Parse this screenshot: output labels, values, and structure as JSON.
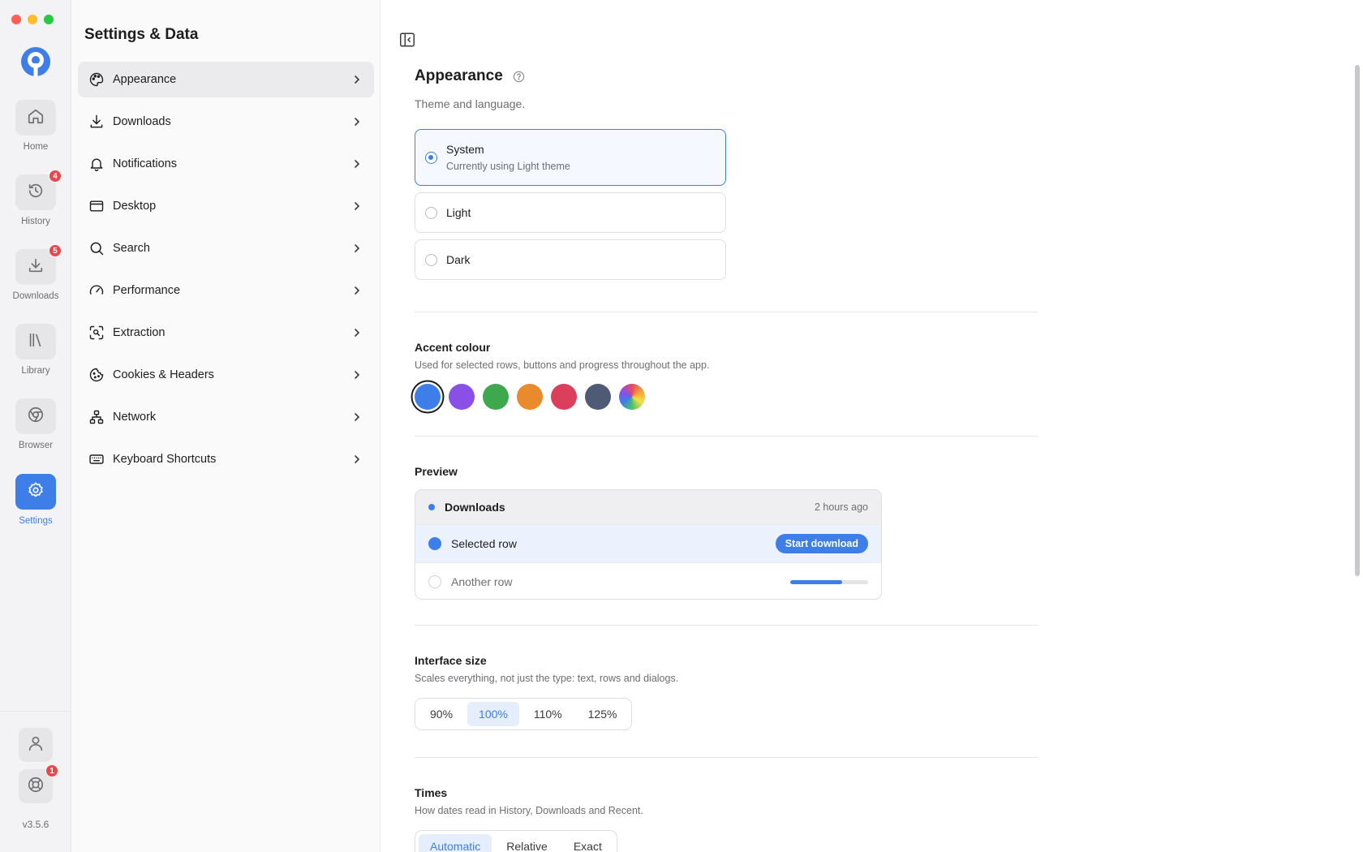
{
  "rail": {
    "items": [
      {
        "label": "Home",
        "icon": "home-icon"
      },
      {
        "label": "History",
        "icon": "history-icon",
        "badge": "4"
      },
      {
        "label": "Downloads",
        "icon": "download-icon",
        "badge": "5"
      },
      {
        "label": "Library",
        "icon": "library-icon"
      },
      {
        "label": "Browser",
        "icon": "browser-icon"
      },
      {
        "label": "Settings",
        "icon": "gear-icon",
        "active": true
      }
    ],
    "support_badge": "1",
    "version": "v3.5.6"
  },
  "nav": {
    "title": "Settings & Data",
    "items": [
      {
        "label": "Appearance",
        "icon": "palette-icon"
      },
      {
        "label": "Downloads",
        "icon": "download-icon"
      },
      {
        "label": "Notifications",
        "icon": "bell-icon"
      },
      {
        "label": "Desktop",
        "icon": "window-icon"
      },
      {
        "label": "Search",
        "icon": "search-icon"
      },
      {
        "label": "Performance",
        "icon": "gauge-icon"
      },
      {
        "label": "Extraction",
        "icon": "scan-icon"
      },
      {
        "label": "Cookies & Headers",
        "icon": "cookie-icon"
      },
      {
        "label": "Network",
        "icon": "network-icon"
      },
      {
        "label": "Keyboard Shortcuts",
        "icon": "keyboard-icon"
      }
    ]
  },
  "appearance": {
    "title": "Appearance",
    "subtitle": "Theme and language.",
    "theme_options": [
      {
        "label": "System",
        "sub": "Currently using Light theme",
        "selected": true
      },
      {
        "label": "Light"
      },
      {
        "label": "Dark"
      }
    ]
  },
  "accent": {
    "title": "Accent colour",
    "subtitle": "Used for selected rows, buttons and progress throughout the app.",
    "colors": [
      "#3d7ee8",
      "#8a4fe6",
      "#3ea84e",
      "#e98a2c",
      "#dc3f5c",
      "#4f5b75",
      "multicolor"
    ],
    "selected_index": 0
  },
  "preview": {
    "title": "Preview",
    "header_label": "Downloads",
    "header_time": "2 hours ago",
    "selected_row": "Selected row",
    "button_label": "Start download",
    "other_row": "Another row",
    "progress": 0.67
  },
  "interface_size": {
    "title": "Interface size",
    "subtitle": "Scales everything, not just the type: text, rows and dialogs.",
    "options": [
      "90%",
      "100%",
      "110%",
      "125%"
    ],
    "selected_index": 1
  },
  "times": {
    "title": "Times",
    "subtitle": "How dates read in History, Downloads and Recent.",
    "options": [
      "Automatic",
      "Relative",
      "Exact"
    ],
    "selected_index": 0
  },
  "colors": {
    "accent": "#3d7ee8",
    "badge": "#e5484d"
  }
}
